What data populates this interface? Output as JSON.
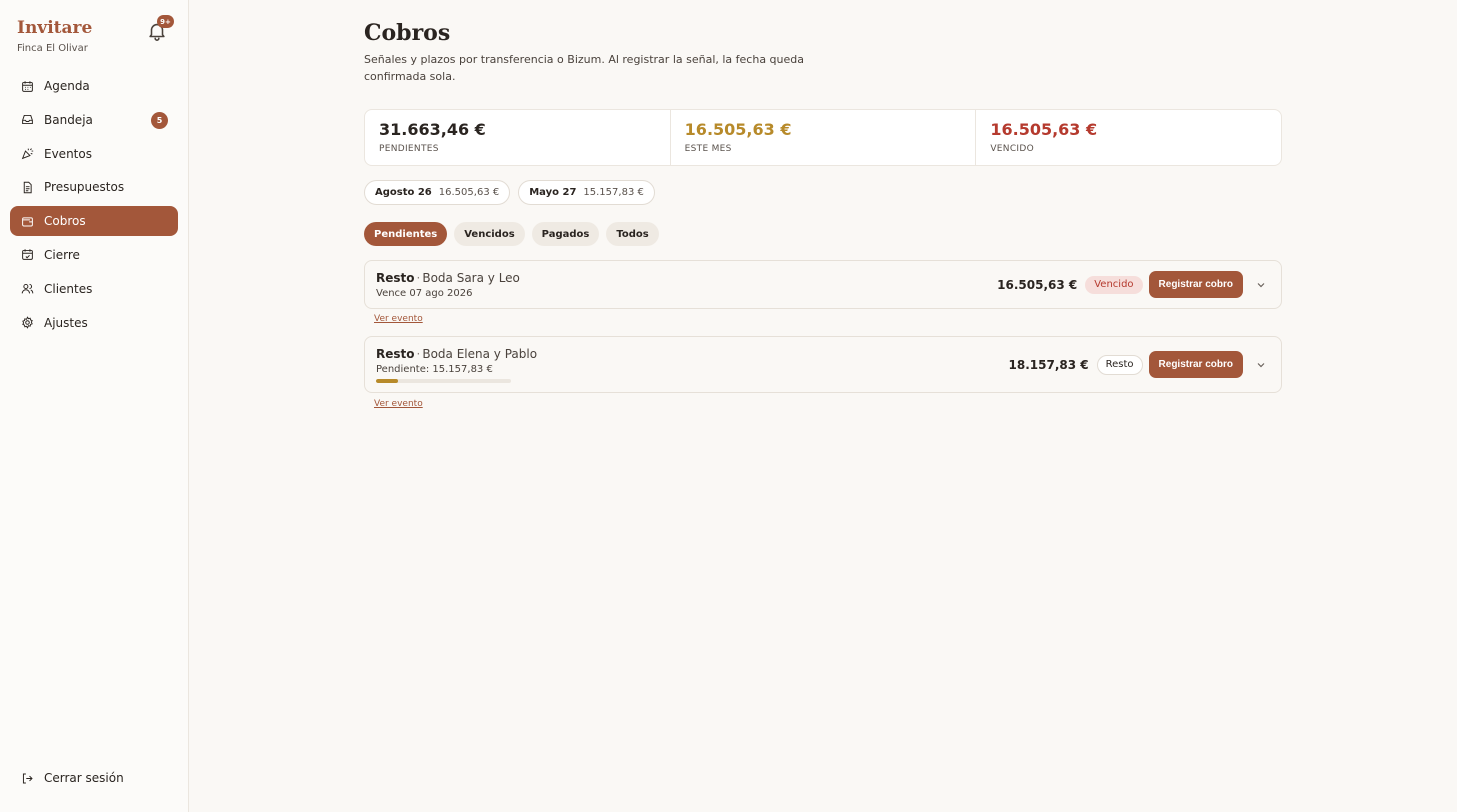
{
  "sidebar": {
    "brand": "Invitare",
    "venue": "Finca El Olivar",
    "notifications_badge": "9+",
    "items": [
      {
        "label": "Agenda",
        "icon": "calendar-icon"
      },
      {
        "label": "Bandeja",
        "icon": "inbox-icon",
        "count": "5"
      },
      {
        "label": "Eventos",
        "icon": "party-icon"
      },
      {
        "label": "Presupuestos",
        "icon": "document-icon"
      },
      {
        "label": "Cobros",
        "icon": "wallet-icon",
        "active": true
      },
      {
        "label": "Cierre",
        "icon": "calendar-check-icon"
      },
      {
        "label": "Clientes",
        "icon": "users-icon"
      },
      {
        "label": "Ajustes",
        "icon": "gear-icon"
      }
    ],
    "logout": "Cerrar sesión"
  },
  "page": {
    "title": "Cobros",
    "description": "Señales y plazos por transferencia o Bizum. Al registrar la señal, la fecha queda confirmada sola."
  },
  "stats": [
    {
      "value": "31.663,46 €",
      "label": "PENDIENTES",
      "color": "#2a2420"
    },
    {
      "value": "16.505,63 €",
      "label": "ESTE MES",
      "color": "#b78a2a"
    },
    {
      "value": "16.505,63 €",
      "label": "VENCIDO",
      "color": "#b53a2e"
    }
  ],
  "months": [
    {
      "label": "Agosto 26",
      "amount": "16.505,63 €"
    },
    {
      "label": "Mayo 27",
      "amount": "15.157,83 €"
    }
  ],
  "filters": [
    {
      "label": "Pendientes",
      "active": true
    },
    {
      "label": "Vencidos"
    },
    {
      "label": "Pagados"
    },
    {
      "label": "Todos"
    }
  ],
  "payments": [
    {
      "type": "Resto",
      "event": "Boda Sara y Leo",
      "subtitle": "Vence 07 ago 2026",
      "amount": "16.505,63 €",
      "badge": "Vencido",
      "action": "Registrar cobro",
      "link": "Ver evento"
    },
    {
      "type": "Resto",
      "event": "Boda Elena y Pablo",
      "subtitle": "Pendiente: 15.157,83 €",
      "progress": 0.165,
      "amount": "18.157,83 €",
      "badge": "Resto",
      "action": "Registrar cobro",
      "link": "Ver evento"
    }
  ],
  "colors": {
    "accent": "#a3573a",
    "warning": "#b78a2a",
    "danger": "#b53a2e"
  }
}
